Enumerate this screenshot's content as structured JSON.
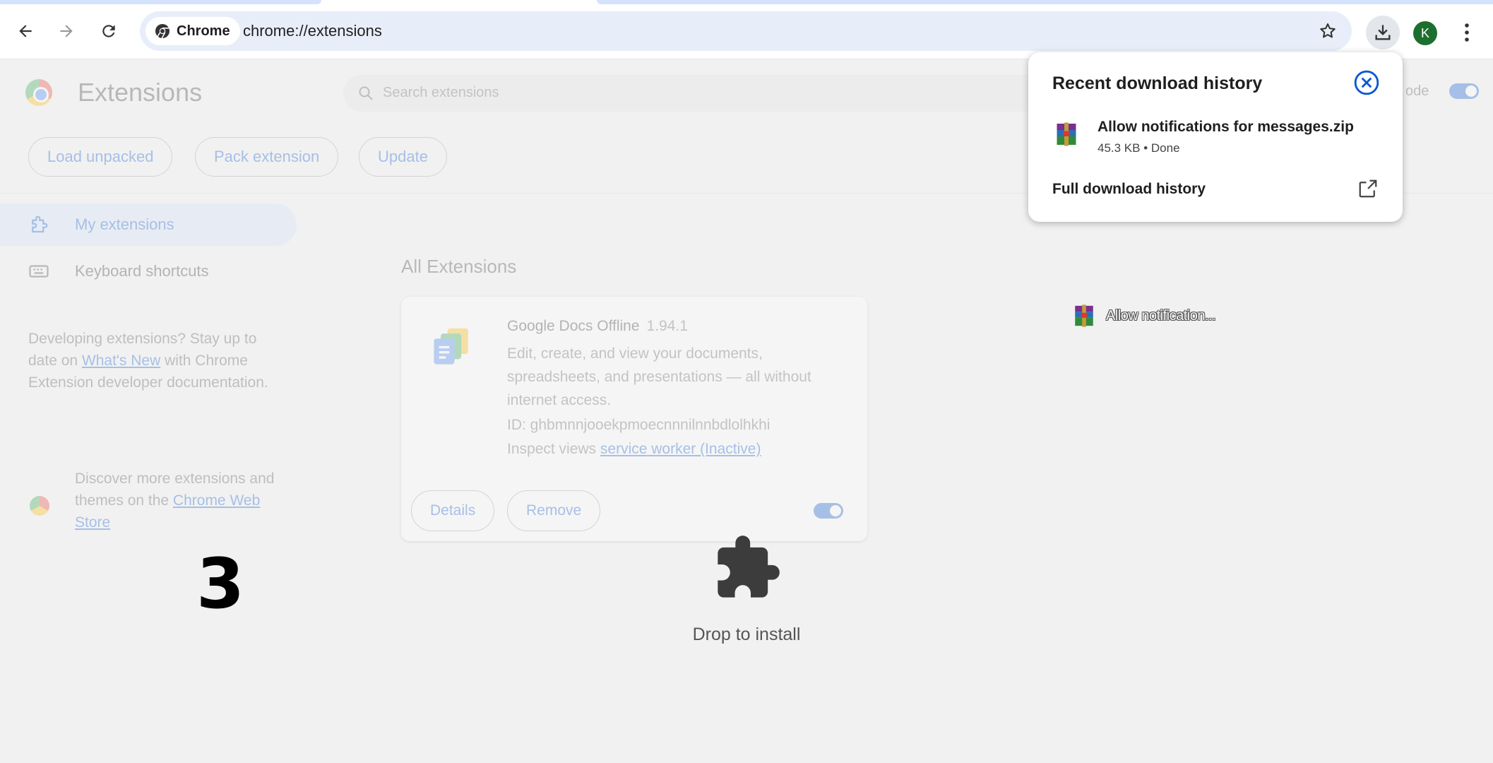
{
  "browser": {
    "omnibox": {
      "chip_label": "Chrome",
      "url": "chrome://extensions"
    },
    "avatar_initial": "K",
    "icons": {
      "back": "arrow-left-icon",
      "forward": "arrow-right-icon",
      "reload": "reload-icon",
      "bookmark": "star-icon",
      "downloads": "download-icon",
      "menu": "more-vertical-icon"
    }
  },
  "extensions_page": {
    "title": "Extensions",
    "search_placeholder": "Search extensions",
    "developer_mode_label": "ode",
    "toolbar_buttons": {
      "load_unpacked": "Load unpacked",
      "pack_extension": "Pack extension",
      "update": "Update"
    },
    "sidebar": {
      "items": [
        {
          "label": "My extensions",
          "active": true
        },
        {
          "label": "Keyboard shortcuts",
          "active": false
        }
      ],
      "dev_text_before": "Developing extensions? Stay up to date on ",
      "dev_link": "What's New",
      "dev_text_after": " with Chrome Extension developer documentation.",
      "store_text": "Discover more extensions and themes on the ",
      "store_link": "Chrome Web Store"
    },
    "section_title": "All Extensions",
    "extension_card": {
      "name": "Google Docs Offline",
      "version": "1.94.1",
      "description": "Edit, create, and view your documents, spreadsheets, and presentations — all without internet access.",
      "id_line": "ID: ghbmnnjooekpmoecnnnilnnbdlolhkhi",
      "inspect_label": "Inspect views",
      "inspect_link": "service worker (Inactive)",
      "details_button": "Details",
      "remove_button": "Remove",
      "enabled": true
    }
  },
  "drop_overlay": {
    "label": "Drop to install",
    "icon": "puzzle-piece-icon",
    "drag_ghost_text": "Allow notification..."
  },
  "annotation_number": "3",
  "download_bubble": {
    "title": "Recent download history",
    "items": [
      {
        "filename": "Allow notifications for messages.zip",
        "meta": "45.3 KB • Done",
        "icon": "winrar-archive-icon"
      }
    ],
    "full_history_label": "Full download history"
  },
  "colors": {
    "accent": "#0b57d0",
    "omnibox_bg": "#e8eef9",
    "avatar_bg": "#1e6e2f"
  }
}
